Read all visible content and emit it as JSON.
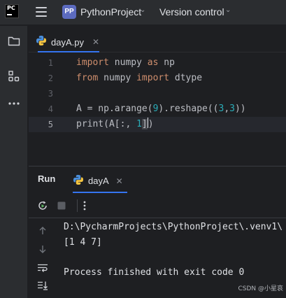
{
  "titlebar": {
    "badge": "PP",
    "project_name": "PythonProject",
    "vcs_label": "Version control"
  },
  "editor": {
    "tab_label": "dayA.py",
    "lines": [
      {
        "number": "1",
        "text": "import numpy as np"
      },
      {
        "number": "2",
        "text": "from numpy import dtype"
      },
      {
        "number": "3",
        "text": ""
      },
      {
        "number": "4",
        "text": "A = np.arange(9).reshape((3,3))"
      },
      {
        "number": "5",
        "text": "print(A[:, 1])"
      }
    ],
    "current_line": 5
  },
  "run": {
    "title": "Run",
    "tab_label": "dayA",
    "output": [
      "D:\\PycharmProjects\\PythonProject\\.venv1\\",
      "[1 4 7]",
      "",
      "Process finished with exit code 0"
    ]
  },
  "watermark": "CSDN @小星哀",
  "colors": {
    "accent": "#3574f0",
    "keyword": "#cf8e6d",
    "number": "#2aacb8",
    "rerun_icon": "#5fb865"
  },
  "icons": [
    "pycharm-logo-icon",
    "hamburger-menu-icon",
    "folder-icon",
    "structure-icon",
    "more-icon",
    "python-file-icon",
    "close-icon",
    "rerun-icon",
    "stop-icon",
    "options-icon",
    "scroll-up-icon",
    "scroll-down-icon",
    "soft-wrap-icon",
    "scroll-to-end-icon"
  ]
}
